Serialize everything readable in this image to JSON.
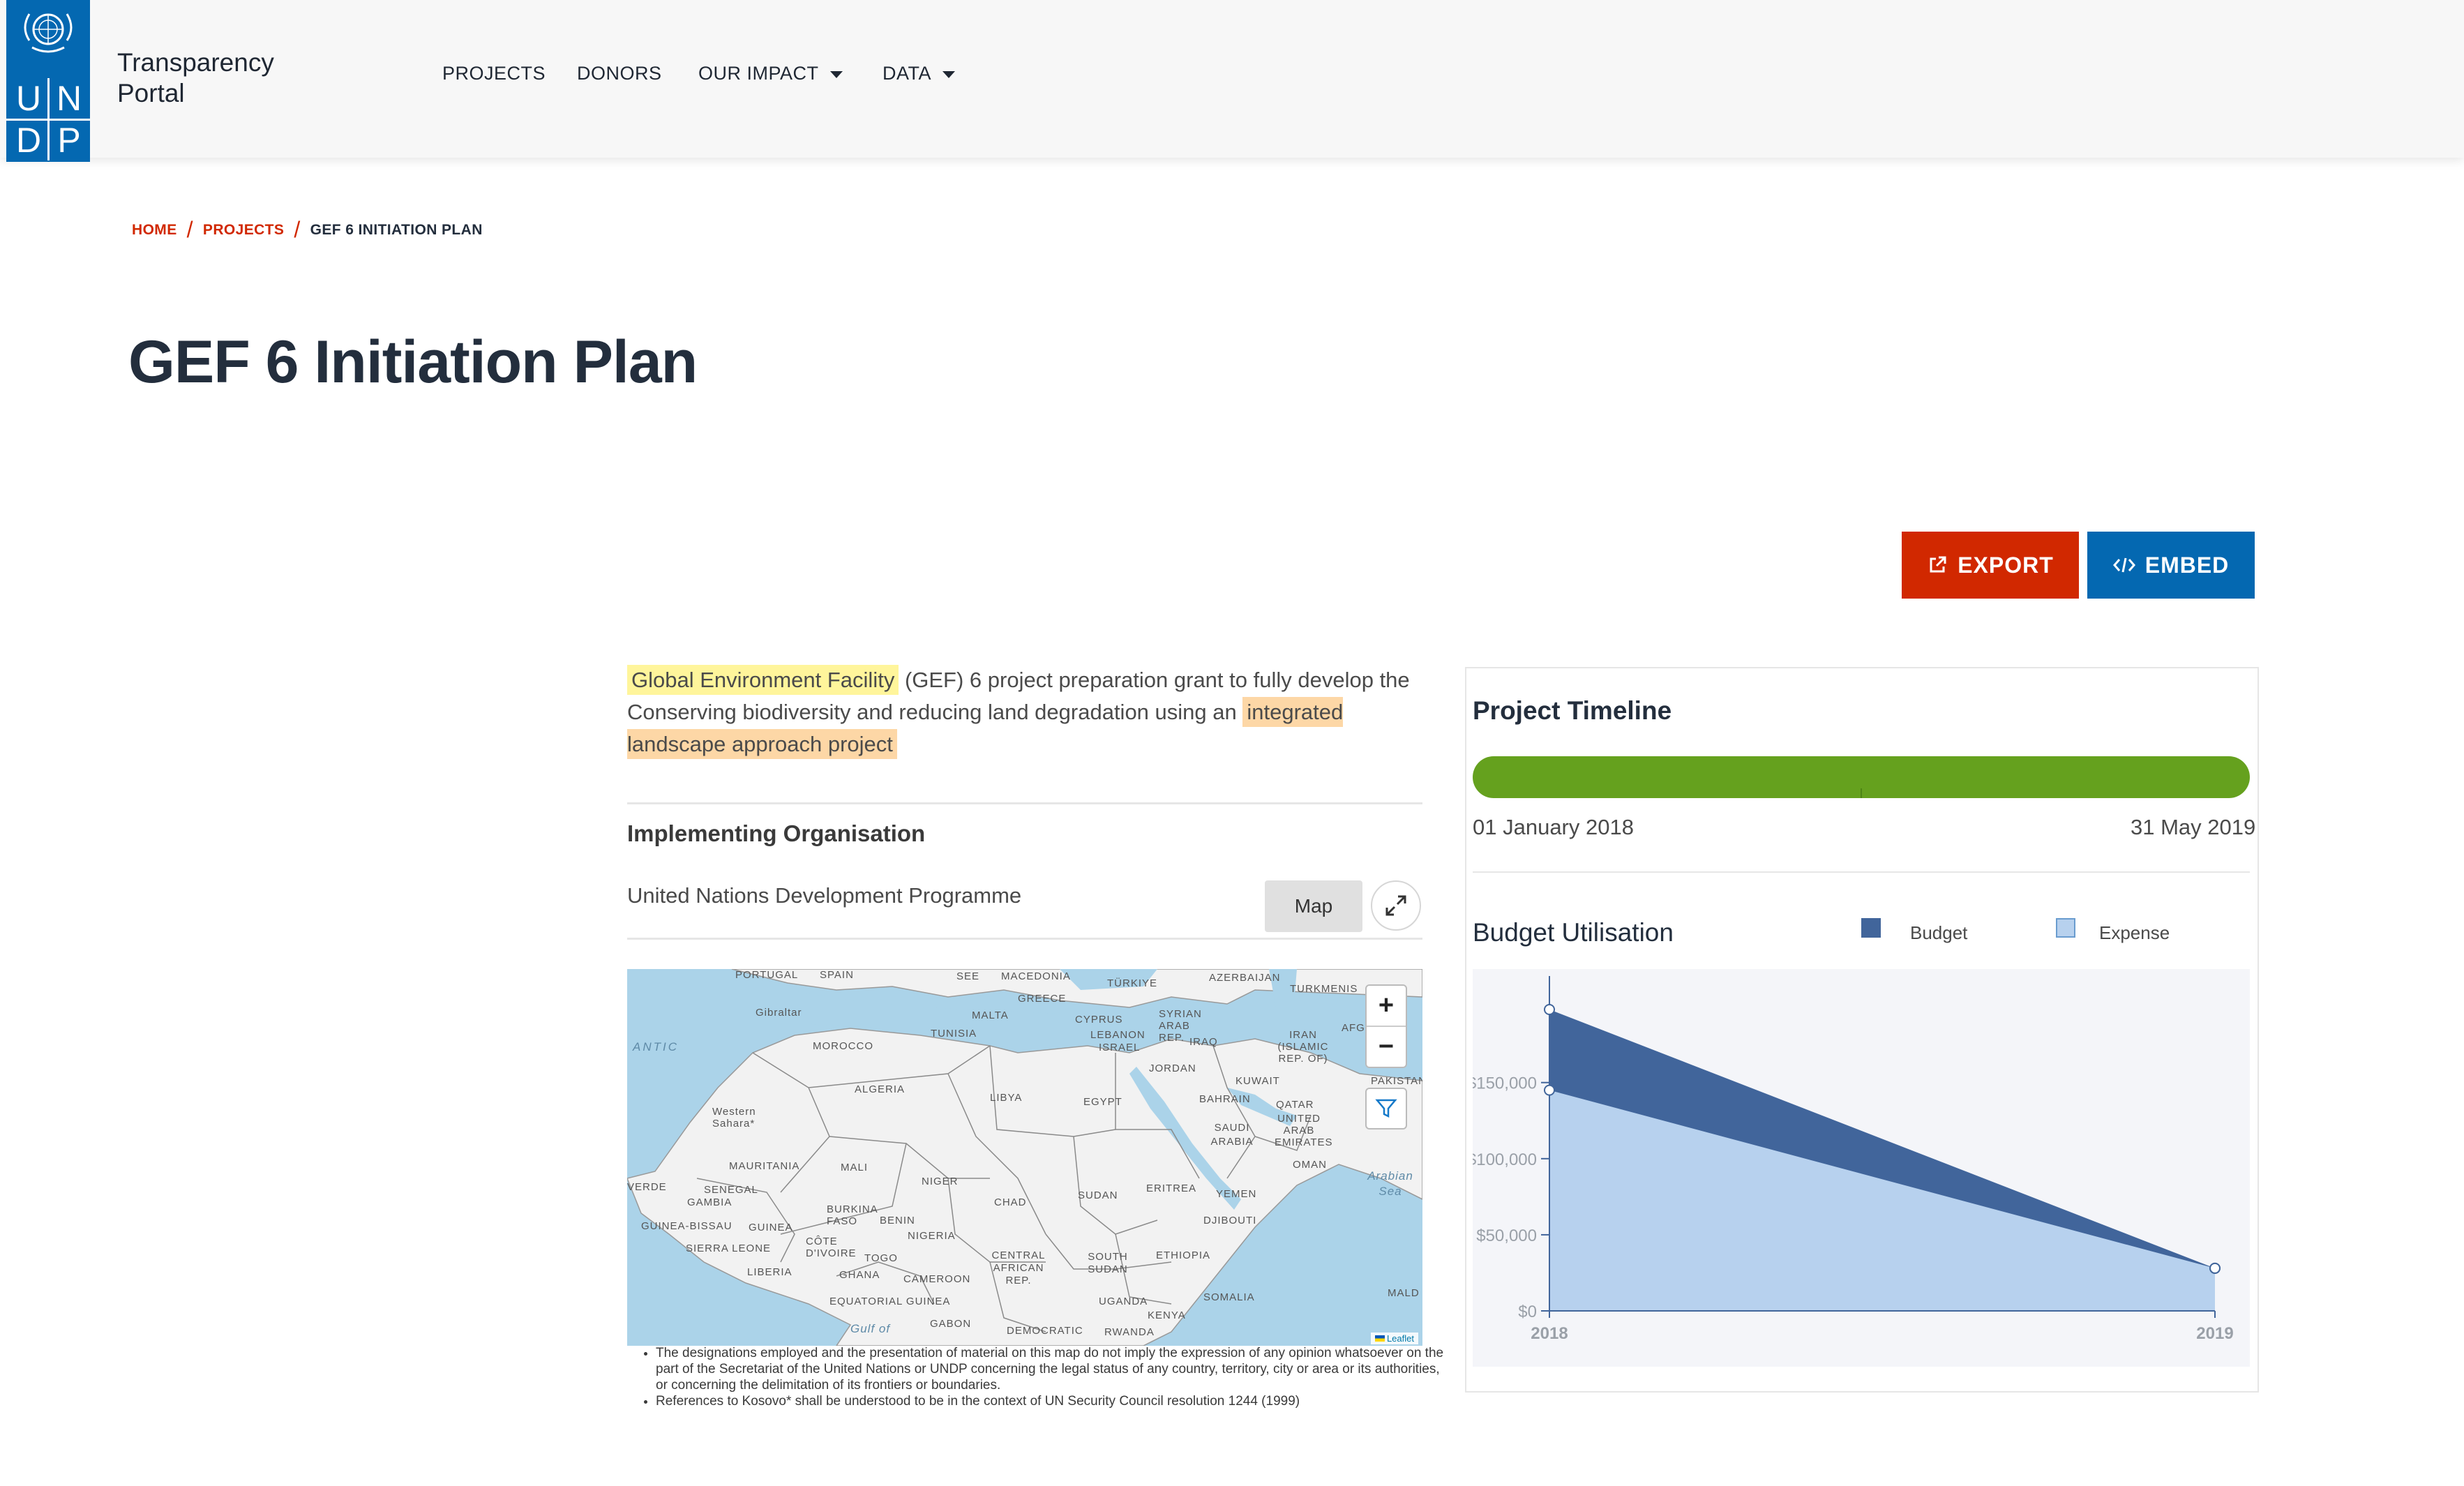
{
  "header": {
    "logo_letters": [
      "U",
      "N",
      "D",
      "P"
    ],
    "title_line1": "Transparency",
    "title_line2": "Portal",
    "nav": [
      {
        "label": "PROJECTS",
        "dropdown": false
      },
      {
        "label": "DONORS",
        "dropdown": false
      },
      {
        "label": "OUR IMPACT",
        "dropdown": true
      },
      {
        "label": "DATA",
        "dropdown": true
      }
    ]
  },
  "breadcrumb": {
    "home": "HOME",
    "projects": "PROJECTS",
    "current": "GEF 6 INITIATION PLAN"
  },
  "page_title": "GEF 6 Initiation Plan",
  "actions": {
    "export_label": "EXPORT",
    "embed_label": "EMBED"
  },
  "description": {
    "highlight1": "Global Environment Facility",
    "text1": " (GEF) 6 project preparation grant to fully develop the Conserving biodiversity and reducing land degradation using an ",
    "highlight2": "integrated landscape approach project"
  },
  "implementing": {
    "heading": "Implementing Organisation",
    "value": "United Nations Development Programme",
    "map_button": "Map"
  },
  "map": {
    "labels": [
      "PORTUGAL",
      "SPAIN",
      "SEE",
      "MACEDONIA",
      "TÜRKIYE",
      "AZERBAIJAN",
      "TURKMENIS",
      "Gibraltar",
      "GREECE",
      "MALTA",
      "CYPRUS",
      "SYRIAN ARAB REP.",
      "LEBANON",
      "ISRAEL",
      "IRAQ",
      "IRAN (ISLAMIC REP. OF)",
      "AFG",
      "MOROCCO",
      "TUNISIA",
      "JORDAN",
      "KUWAIT",
      "PAKISTAN",
      "ALGERIA",
      "LIBYA",
      "EGYPT",
      "BAHRAIN",
      "QATAR",
      "UNITED ARAB EMIRATES",
      "Western Sahara*",
      "SAUDI ARABIA",
      "OMAN",
      "MAURITANIA",
      "MALI",
      "NIGER",
      "CHAD",
      "SUDAN",
      "ERITREA",
      "YEMEN",
      "SENEGAL",
      "GAMBIA",
      "BURKINA FASO",
      "BENIN",
      "DJIBOUTI",
      "GUINEA-BISSAU",
      "GUINEA",
      "NIGERIA",
      "SIERRA LEONE",
      "CÔTE D'IVOIRE",
      "TOGO",
      "CENTRAL AFRICAN REP.",
      "SOUTH SUDAN",
      "ETHIOPIA",
      "LIBERIA",
      "GHANA",
      "CAMEROON",
      "SOMALIA",
      "EQUATORIAL GUINEA",
      "UGANDA",
      "KENYA",
      "GABON",
      "DEMOCRATIC",
      "RWANDA",
      "VERDE",
      "MALD"
    ],
    "seas": [
      "ANTIC",
      "Arabian Sea",
      "Gulf of"
    ],
    "zoom_in": "+",
    "zoom_out": "−",
    "attribution": "Leaflet",
    "notes": [
      "The designations employed and the presentation of material on this map do not imply the expression of any opinion whatsoever on the part of the Secretariat of the United Nations or UNDP concerning the legal status of any country, territory, city or area or its authorities, or concerning the delimitation of its frontiers or boundaries.",
      "References to Kosovo* shall be understood to be in the context of UN Security Council resolution 1244 (1999)"
    ]
  },
  "timeline": {
    "heading": "Project Timeline",
    "start": "01 January 2018",
    "end": "31 May 2019",
    "progress": 1.0,
    "color": "#65a11e"
  },
  "budget": {
    "heading": "Budget Utilisation",
    "legend_budget": "Budget",
    "legend_expense": "Expense"
  },
  "chart_data": {
    "type": "area",
    "x": [
      "2018",
      "2019"
    ],
    "series": [
      {
        "name": "Budget",
        "values": [
          198000,
          28000
        ],
        "color": "#41659b"
      },
      {
        "name": "Expense",
        "values": [
          145000,
          28000
        ],
        "color": "#b7d1ee"
      }
    ],
    "ylim": [
      0,
      220000
    ],
    "yticks": [
      0,
      50000,
      100000,
      150000
    ],
    "ytick_labels": [
      "$0",
      "$50,000",
      "$100,000",
      "$150,000"
    ],
    "xlabel": "",
    "ylabel": ""
  },
  "colors": {
    "brand_blue": "#0468b1",
    "export_red": "#d12800",
    "timeline_green": "#65a11e",
    "highlight_yellow": "#fff59b",
    "highlight_orange": "#fdd7a6"
  }
}
